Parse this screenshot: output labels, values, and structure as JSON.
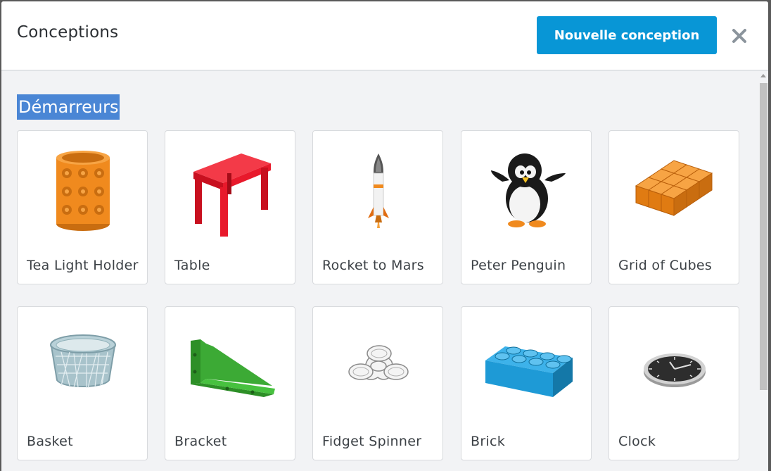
{
  "dialog": {
    "title": "Conceptions",
    "new_button_label": "Nouvelle conception",
    "close_icon": "close-icon"
  },
  "section": {
    "heading": "Démarreurs"
  },
  "starters": [
    {
      "label": "Tea Light Holder",
      "icon": "tea-light-holder-icon",
      "color": "#f08a1e"
    },
    {
      "label": "Table",
      "icon": "table-icon",
      "color": "#e8192b"
    },
    {
      "label": "Rocket to Mars",
      "icon": "rocket-icon",
      "color": "#e8e8e8"
    },
    {
      "label": "Peter Penguin",
      "icon": "penguin-icon",
      "color": "#1a1a1a"
    },
    {
      "label": "Grid of Cubes",
      "icon": "grid-of-cubes-icon",
      "color": "#f08a1e"
    },
    {
      "label": "Basket",
      "icon": "basket-icon",
      "color": "#9ab7c0"
    },
    {
      "label": "Bracket",
      "icon": "bracket-icon",
      "color": "#3caa35"
    },
    {
      "label": "Fidget Spinner",
      "icon": "fidget-spinner-icon",
      "color": "#e6e6e6"
    },
    {
      "label": "Brick",
      "icon": "brick-icon",
      "color": "#1e9ad6"
    },
    {
      "label": "Clock",
      "icon": "clock-icon",
      "color": "#2d2d2d"
    }
  ],
  "colors": {
    "accent": "#0896d6",
    "selection": "#4a86d5"
  }
}
